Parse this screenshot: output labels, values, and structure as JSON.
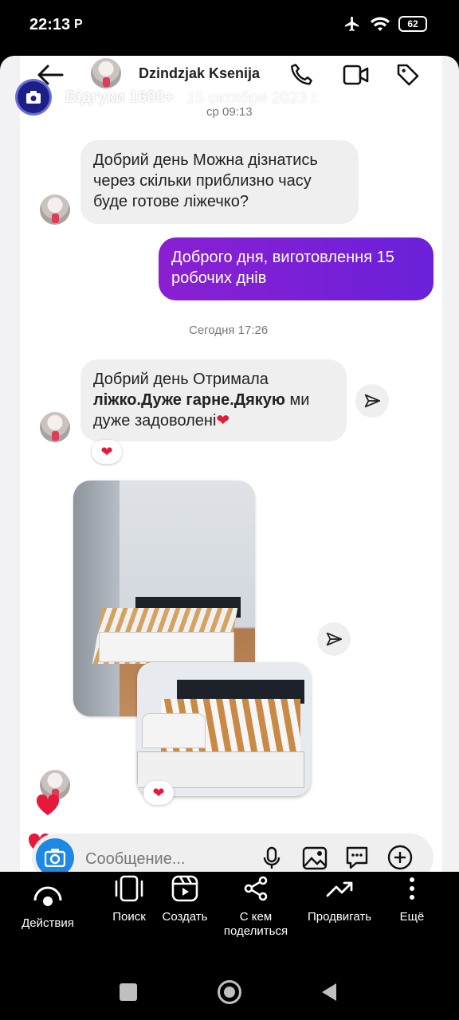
{
  "status_bar": {
    "time": "22:13",
    "carrier_icon": "P",
    "battery": "62"
  },
  "chat_header": {
    "contact_name": "Dzindzjak Ksenija"
  },
  "overlay": {
    "title": "Відгуки 1600+",
    "date": "15 октября 2023 г."
  },
  "messages": [
    {
      "type": "timestamp",
      "text": "ср 09:13"
    },
    {
      "type": "incoming",
      "lines": [
        "Добрий день Можна дізнатись",
        "через скільки приблизно часу",
        "буде готове ліжечко?"
      ]
    },
    {
      "type": "outgoing",
      "lines": [
        "Доброго дня, виготовлення 15",
        "робочих днів"
      ]
    },
    {
      "type": "timestamp",
      "text": "Сегодня 17:26"
    },
    {
      "type": "incoming",
      "line1": "Добрий день Отримала",
      "line2_bold": "ліжко.Дуже гарне.Дякую",
      "line2_rest": " ми",
      "line3": "дуже задоволені",
      "reaction": "❤"
    },
    {
      "type": "photos",
      "description_icons": [
        "bed-photo-1",
        "bed-photo-2"
      ],
      "reaction": "❤"
    }
  ],
  "composer": {
    "placeholder": "Сообщение..."
  },
  "toolbar": [
    {
      "label": "Действия"
    },
    {
      "label": "Поиск"
    },
    {
      "label": "Создать"
    },
    {
      "label_line1": "С кем",
      "label_line2": "поделиться"
    },
    {
      "label": "Продвигать"
    },
    {
      "label": "Ещё"
    }
  ],
  "colors": {
    "outgoing_bubble": "#7a1fd6",
    "heart": "#e6193b",
    "camera_button": "#1e88e5"
  }
}
